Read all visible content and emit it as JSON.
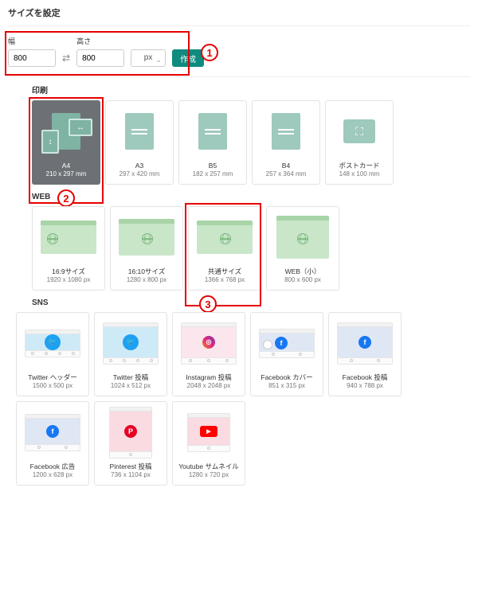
{
  "title": "サイズを設定",
  "custom": {
    "width_label": "幅",
    "height_label": "高さ",
    "width_value": "800",
    "height_value": "800",
    "unit": "px",
    "create_label": "作成"
  },
  "annotations": {
    "one": "1",
    "two": "2",
    "three": "3"
  },
  "sections": {
    "print": {
      "label": "印刷",
      "cards": [
        {
          "name": "A4",
          "dim": "210 x 297 mm"
        },
        {
          "name": "A3",
          "dim": "297 x 420 mm"
        },
        {
          "name": "B5",
          "dim": "182 x 257 mm"
        },
        {
          "name": "B4",
          "dim": "257 x 364 mm"
        },
        {
          "name": "ポストカード",
          "dim": "148 x 100 mm"
        }
      ]
    },
    "web": {
      "label": "WEB",
      "cards": [
        {
          "name": "16:9サイズ",
          "dim": "1920 x 1080 px"
        },
        {
          "name": "16:10サイズ",
          "dim": "1280 x 800 px"
        },
        {
          "name": "共通サイズ",
          "dim": "1366 x 768 px"
        },
        {
          "name": "WEB（小）",
          "dim": "800 x 600 px"
        }
      ]
    },
    "sns": {
      "label": "SNS",
      "cards": [
        {
          "name": "Twitter ヘッダー",
          "dim": "1500 x 500 px"
        },
        {
          "name": "Twitter 投稿",
          "dim": "1024 x 512 px"
        },
        {
          "name": "Instagram 投稿",
          "dim": "2048 x 2048 px"
        },
        {
          "name": "Facebook カバー",
          "dim": "851 x 315 px"
        },
        {
          "name": "Facebook 投稿",
          "dim": "940 x 788 px"
        },
        {
          "name": "Facebook 広告",
          "dim": "1200 x 628 px"
        },
        {
          "name": "Pinterest 投稿",
          "dim": "736 x 1104 px"
        },
        {
          "name": "Youtube サムネイル",
          "dim": "1280 x 720 px"
        }
      ]
    }
  }
}
